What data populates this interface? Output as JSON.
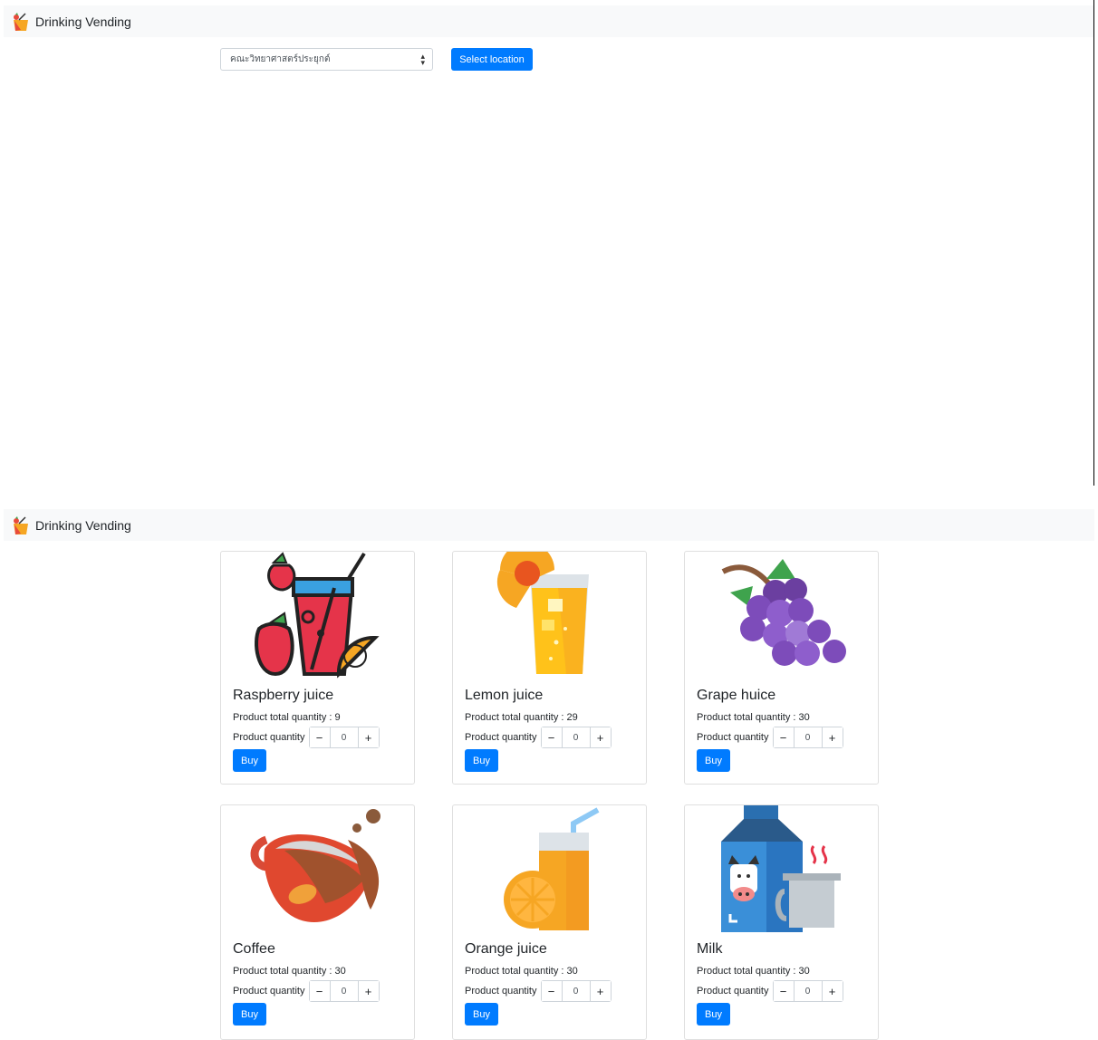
{
  "brand": {
    "title": "Drinking Vending"
  },
  "location": {
    "selected": "คณะวิทยาศาสตร์ประยุกต์",
    "button_label": "Select location"
  },
  "colors": {
    "primary": "#007bff",
    "navbar_bg": "#f8f9fa"
  },
  "products": [
    {
      "name": "Raspberry juice",
      "total_label": "Product total quantity : 9",
      "qty_label": "Product quantity",
      "qty": "0",
      "minus": "−",
      "plus": "+",
      "buy": "Buy",
      "icon": "raspberry-juice-icon"
    },
    {
      "name": "Lemon juice",
      "total_label": "Product total quantity : 29",
      "qty_label": "Product quantity",
      "qty": "0",
      "minus": "−",
      "plus": "+",
      "buy": "Buy",
      "icon": "lemon-juice-icon"
    },
    {
      "name": "Grape huice",
      "total_label": "Product total quantity : 30",
      "qty_label": "Product quantity",
      "qty": "0",
      "minus": "−",
      "plus": "+",
      "buy": "Buy",
      "icon": "grape-icon"
    },
    {
      "name": "Coffee",
      "total_label": "Product total quantity : 30",
      "qty_label": "Product quantity",
      "qty": "0",
      "minus": "−",
      "plus": "+",
      "buy": "Buy",
      "icon": "coffee-icon"
    },
    {
      "name": "Orange juice",
      "total_label": "Product total quantity : 30",
      "qty_label": "Product quantity",
      "qty": "0",
      "minus": "−",
      "plus": "+",
      "buy": "Buy",
      "icon": "orange-juice-icon"
    },
    {
      "name": "Milk",
      "total_label": "Product total quantity : 30",
      "qty_label": "Product quantity",
      "qty": "0",
      "minus": "−",
      "plus": "+",
      "buy": "Buy",
      "icon": "milk-icon"
    }
  ]
}
